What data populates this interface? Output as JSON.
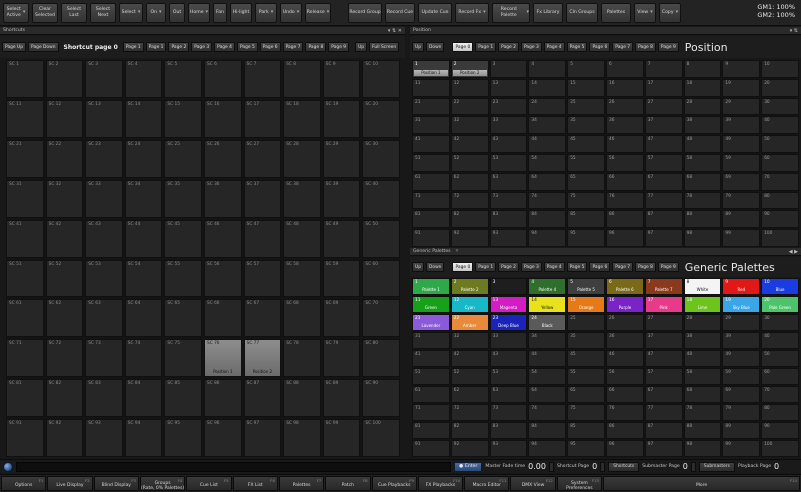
{
  "toolbar": {
    "buttons": [
      {
        "label": "Select\nActive",
        "dropdown": true
      },
      {
        "label": "Clear\nSelected",
        "dropdown": false
      },
      {
        "label": "Select\nLast",
        "dropdown": false
      },
      {
        "label": "Select\nNext",
        "dropdown": false
      },
      {
        "label": "Select",
        "dropdown": true
      },
      {
        "label": "On",
        "dropdown": true
      },
      {
        "label": "Out",
        "dropdown": false
      },
      {
        "label": "Home",
        "dropdown": true
      },
      {
        "label": "Fan",
        "dropdown": false
      },
      {
        "label": "Hi-light",
        "dropdown": false
      },
      {
        "label": "Park",
        "dropdown": true
      },
      {
        "label": "Undo",
        "dropdown": true
      },
      {
        "label": "Release",
        "dropdown": true
      },
      {
        "label": "Record Group",
        "dropdown": false
      },
      {
        "label": "Record Cue",
        "dropdown": false
      },
      {
        "label": "Update Cue",
        "dropdown": false
      },
      {
        "label": "Record Fx",
        "dropdown": true
      },
      {
        "label": "Record Palette",
        "dropdown": true
      },
      {
        "label": "Fx Library",
        "dropdown": false
      },
      {
        "label": "Cln Groups",
        "dropdown": false
      },
      {
        "label": "Palettes",
        "dropdown": false
      },
      {
        "label": "View",
        "dropdown": true
      },
      {
        "label": "Copy",
        "dropdown": true
      }
    ],
    "gm1": "GM1: 100%",
    "gm2": "GM2: 100%"
  },
  "shortcuts": {
    "title": "Shortcuts",
    "buttons": [
      "Page Up",
      "Page Down"
    ],
    "page_title": "Shortcut page 0",
    "pages": [
      "Page 1",
      "Page 1",
      "Page 2",
      "Page 3",
      "Page 4",
      "Page 5",
      "Page 6",
      "Page 7",
      "Page 8",
      "Page 9"
    ],
    "right_buttons": [
      "Up",
      "Full Screen"
    ],
    "cells": [
      "SC 1",
      "SC 2",
      "SC 3",
      "SC 4",
      "SC 5",
      "SC 6",
      "SC 7",
      "SC 8",
      "SC 9",
      "SC 10",
      "SC 11",
      "SC 12",
      "SC 13",
      "SC 14",
      "SC 15",
      "SC 16",
      "SC 17",
      "SC 18",
      "SC 19",
      "SC 20",
      "SC 21",
      "SC 22",
      "SC 23",
      "SC 24",
      "SC 25",
      "SC 26",
      "SC 27",
      "SC 28",
      "SC 29",
      "SC 30",
      "SC 31",
      "SC 32",
      "SC 33",
      "SC 34",
      "SC 35",
      "SC 36",
      "SC 37",
      "SC 38",
      "SC 39",
      "SC 40",
      "SC 41",
      "SC 42",
      "SC 43",
      "SC 44",
      "SC 45",
      "SC 46",
      "SC 47",
      "SC 48",
      "SC 49",
      "SC 50",
      "SC 51",
      "SC 52",
      "SC 53",
      "SC 54",
      "SC 55",
      "SC 56",
      "SC 57",
      "SC 58",
      "SC 59",
      "SC 60",
      "SC 61",
      "SC 62",
      "SC 63",
      "SC 64",
      "SC 65",
      "SC 66",
      "SC 67",
      "SC 68",
      "SC 69",
      "SC 70",
      "SC 71",
      "SC 72",
      "SC 73",
      "SC 74",
      "SC 75",
      "SC 76",
      "SC 77",
      "SC 78",
      "SC 79",
      "SC 80",
      "SC 81",
      "SC 82",
      "SC 83",
      "SC 84",
      "SC 85",
      "SC 86",
      "SC 87",
      "SC 88",
      "SC 89",
      "SC 90",
      "SC 91",
      "SC 92",
      "SC 93",
      "SC 94",
      "SC 95",
      "SC 96",
      "SC 97",
      "SC 98",
      "SC 99",
      "SC 100"
    ],
    "stored": {
      "SC 76": "Position 1",
      "SC 77": "Position 2"
    }
  },
  "position": {
    "title": "Position",
    "buttons": [
      "Up",
      "Down"
    ],
    "pages": [
      "Page 0",
      "Page 1",
      "Page 2",
      "Page 3",
      "Page 4",
      "Page 5",
      "Page 6",
      "Page 7",
      "Page 8",
      "Page 9"
    ],
    "active_page": "Page 0",
    "big_title": "Position",
    "filled": {
      "1": "Position 1",
      "2": "Position 2"
    }
  },
  "generic": {
    "title": "Generic Palettes",
    "buttons": [
      "Up",
      "Down"
    ],
    "pages": [
      "Page 0",
      "Page 1",
      "Page 2",
      "Page 3",
      "Page 4",
      "Page 5",
      "Page 6",
      "Page 7",
      "Page 8",
      "Page 9"
    ],
    "active_page": "Page 0",
    "big_title": "Generic Palettes",
    "filled": [
      {
        "n": 1,
        "label": "Palette 1",
        "color": "#2fa84a"
      },
      {
        "n": 2,
        "label": "Palette 2",
        "color": "#6e7a22"
      },
      {
        "n": 3,
        "label": "",
        "color": "#1e1e1e"
      },
      {
        "n": 4,
        "label": "Palette 4",
        "color": "#2f6e2c"
      },
      {
        "n": 5,
        "label": "Palette 5",
        "color": "#3f3f3f"
      },
      {
        "n": 6,
        "label": "Palette 6",
        "color": "#7a6a18"
      },
      {
        "n": 7,
        "label": "Palette 7",
        "color": "#8a3a1c"
      },
      {
        "n": 8,
        "label": "White",
        "color": "#f4f4f4"
      },
      {
        "n": 9,
        "label": "Red",
        "color": "#e01818"
      },
      {
        "n": 10,
        "label": "Blue",
        "color": "#1a3ce0"
      },
      {
        "n": 11,
        "label": "Green",
        "color": "#17a01a"
      },
      {
        "n": 12,
        "label": "Cyan",
        "color": "#18b8c8"
      },
      {
        "n": 13,
        "label": "Magenta",
        "color": "#d41cc4"
      },
      {
        "n": 14,
        "label": "Yellow",
        "color": "#e8e21c"
      },
      {
        "n": 15,
        "label": "Orange",
        "color": "#e67a18"
      },
      {
        "n": 16,
        "label": "Purple",
        "color": "#7a24c8"
      },
      {
        "n": 17,
        "label": "Pink",
        "color": "#e83a8a"
      },
      {
        "n": 18,
        "label": "Lime",
        "color": "#6cc41c"
      },
      {
        "n": 19,
        "label": "Sky Blue",
        "color": "#3aa6e8"
      },
      {
        "n": 20,
        "label": "Pale Green",
        "color": "#4ec46a"
      },
      {
        "n": 21,
        "label": "Lavender",
        "color": "#8a5ad8"
      },
      {
        "n": 22,
        "label": "Amber",
        "color": "#e88a3a"
      },
      {
        "n": 23,
        "label": "Deep Blue",
        "color": "#1a24b8"
      },
      {
        "n": 24,
        "label": "Black",
        "color": "#5a5a5a"
      }
    ]
  },
  "command": {
    "enter": "Enter",
    "master_fade_label": "Master Fade time",
    "master_fade_value": "0.00",
    "shortcut_page_label": "Shortcut Page",
    "shortcut_page_value": "0",
    "shortcuts_btn": "Shortcuts",
    "submaster_label": "Submaster Page",
    "submaster_value": "0",
    "submasters_btn": "Submasters",
    "playback_label": "Playback Page",
    "playback_value": "0"
  },
  "fkeys": [
    {
      "fn": "F1",
      "label": "Options"
    },
    {
      "fn": "F2",
      "label": "Live Display"
    },
    {
      "fn": "F3",
      "label": "Blind Display"
    },
    {
      "fn": "F4",
      "label": "Groups\n(Rate, 0% Palettes)"
    },
    {
      "fn": "F5",
      "label": "Cue List"
    },
    {
      "fn": "F6",
      "label": "FX List"
    },
    {
      "fn": "F7",
      "label": "Palettes"
    },
    {
      "fn": "F8",
      "label": "Patch"
    },
    {
      "fn": "F9",
      "label": "Cue Playbacks"
    },
    {
      "fn": "F10",
      "label": "FX Playbacks"
    },
    {
      "fn": "F11",
      "label": "Macro Editor"
    },
    {
      "fn": "F12",
      "label": "DMX View"
    },
    {
      "fn": "F13",
      "label": "System\nPreferences"
    },
    {
      "fn": "F14",
      "label": "More"
    }
  ]
}
